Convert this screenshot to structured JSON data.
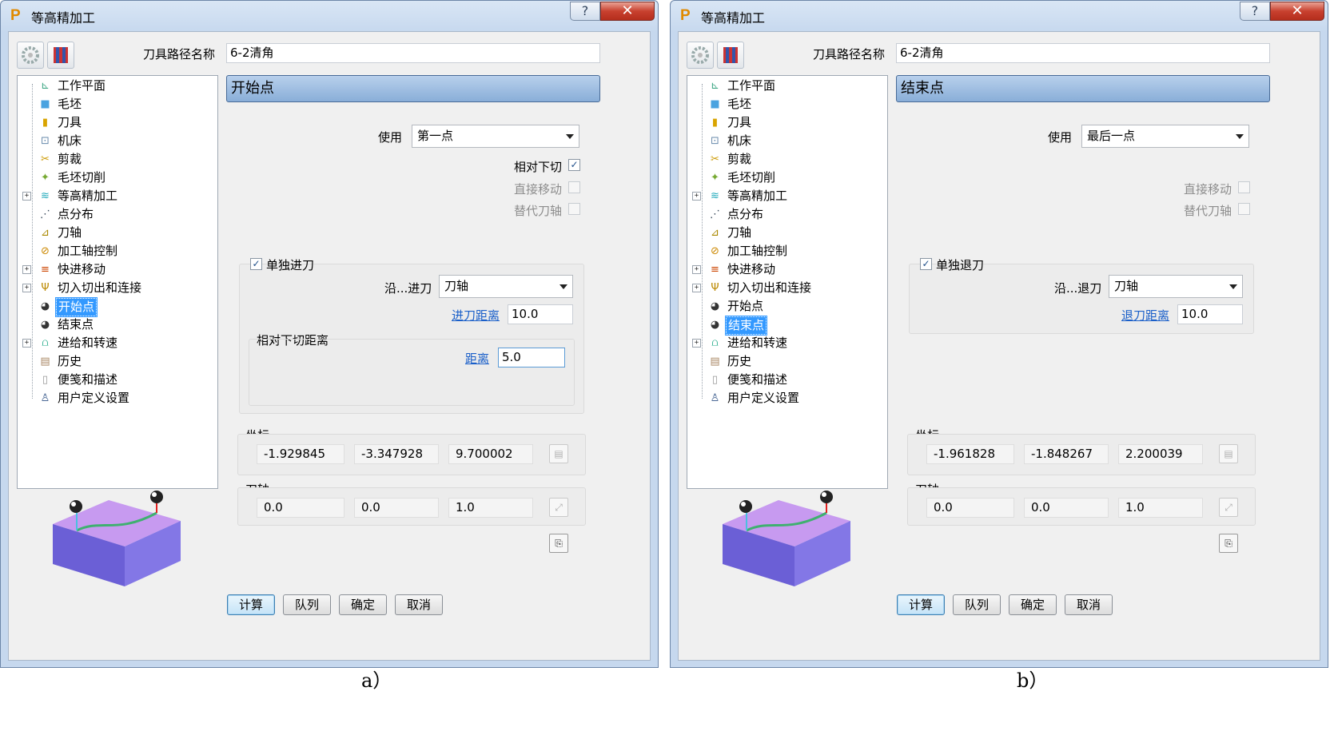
{
  "panels": [
    {
      "window_title": "等高精加工",
      "toolpath_name_label": "刀具路径名称",
      "toolpath_name_value": "6-2清角",
      "section_header": "开始点",
      "use_label": "使用",
      "use_value": "第一点",
      "relative_plunge_label": "相对下切",
      "direct_move_label": "直接移动",
      "alt_tool_axis_label": "替代刀轴",
      "separate_move_label": "单独进刀",
      "along_label": "沿...进刀",
      "along_value": "刀轴",
      "move_distance_label": "进刀距离",
      "move_distance_value": "10.0",
      "relative_group_label": "相对下切距离",
      "distance_label": "距离",
      "distance_value": "5.0",
      "coord_label": "坐标",
      "coords": [
        "-1.929845",
        "-3.347928",
        "9.700002"
      ],
      "tool_axis_label": "刀轴",
      "tool_axis": [
        "0.0",
        "0.0",
        "1.0"
      ],
      "selected_tree_item": 12,
      "caption": "a）"
    },
    {
      "window_title": "等高精加工",
      "toolpath_name_label": "刀具路径名称",
      "toolpath_name_value": "6-2清角",
      "section_header": "结束点",
      "use_label": "使用",
      "use_value": "最后一点",
      "direct_move_label": "直接移动",
      "alt_tool_axis_label": "替代刀轴",
      "separate_move_label": "单独退刀",
      "along_label": "沿...退刀",
      "along_value": "刀轴",
      "move_distance_label": "退刀距离",
      "move_distance_value": "10.0",
      "coord_label": "坐标",
      "coords": [
        "-1.961828",
        "-1.848267",
        "2.200039"
      ],
      "tool_axis_label": "刀轴",
      "tool_axis": [
        "0.0",
        "0.0",
        "1.0"
      ],
      "selected_tree_item": 13,
      "caption": "b）"
    }
  ],
  "tree_items": [
    {
      "label": "工作平面",
      "icon": "workplane-icon",
      "expandable": false
    },
    {
      "label": "毛坯",
      "icon": "block-icon",
      "expandable": false
    },
    {
      "label": "刀具",
      "icon": "tool-icon",
      "expandable": false
    },
    {
      "label": "机床",
      "icon": "machine-icon",
      "expandable": false
    },
    {
      "label": "剪裁",
      "icon": "limit-icon",
      "expandable": false
    },
    {
      "label": "毛坯切削",
      "icon": "stock-cut-icon",
      "expandable": false
    },
    {
      "label": "等高精加工",
      "icon": "layers-icon",
      "expandable": true
    },
    {
      "label": "点分布",
      "icon": "point-distribution-icon",
      "expandable": false
    },
    {
      "label": "刀轴",
      "icon": "tool-axis-icon",
      "expandable": false
    },
    {
      "label": "加工轴控制",
      "icon": "axis-control-icon",
      "expandable": false
    },
    {
      "label": "快进移动",
      "icon": "rapid-move-icon",
      "expandable": true
    },
    {
      "label": "切入切出和连接",
      "icon": "leads-links-icon",
      "expandable": true
    },
    {
      "label": "开始点",
      "icon": "start-point-icon",
      "expandable": false
    },
    {
      "label": "结束点",
      "icon": "end-point-icon",
      "expandable": false
    },
    {
      "label": "进给和转速",
      "icon": "feeds-speeds-icon",
      "expandable": true
    },
    {
      "label": "历史",
      "icon": "history-icon",
      "expandable": false
    },
    {
      "label": "便笺和描述",
      "icon": "notes-icon",
      "expandable": false
    },
    {
      "label": "用户定义设置",
      "icon": "user-settings-icon",
      "expandable": false
    }
  ],
  "buttons": {
    "calculate": "计算",
    "queue": "队列",
    "ok": "确定",
    "cancel": "取消"
  },
  "colors": {
    "header_bar": "#9dbde3",
    "selection": "#3399ff",
    "link": "#1a5fc9",
    "block_top": "#c79af0",
    "block_side": "#6b5fd6"
  }
}
